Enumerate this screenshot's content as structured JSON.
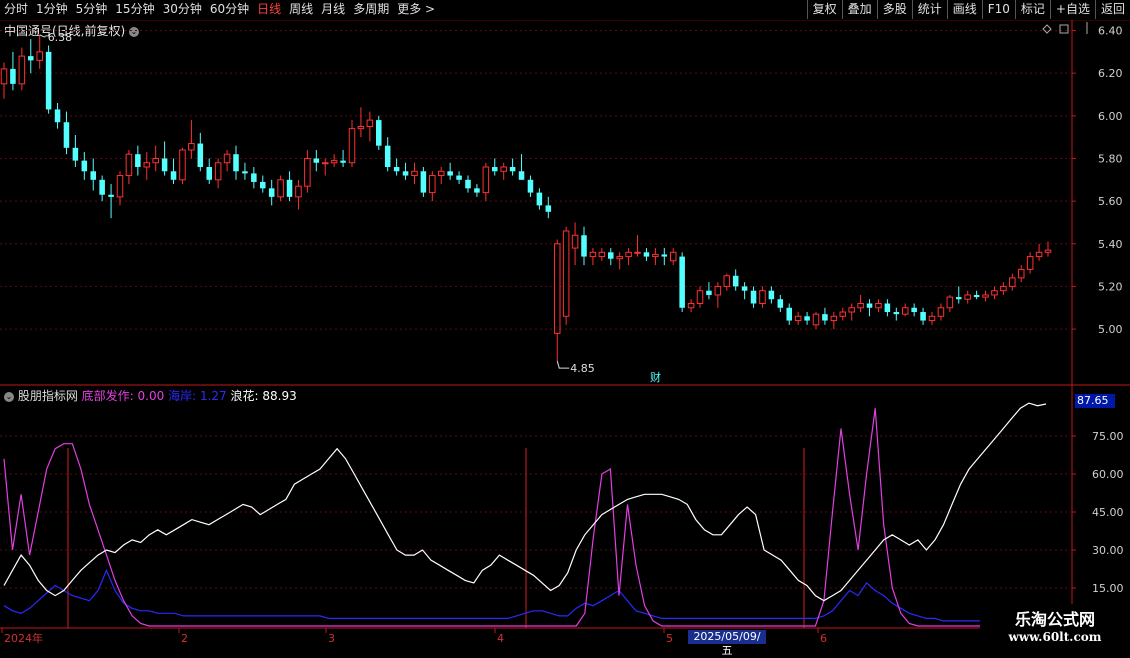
{
  "toolbar": {
    "periods": [
      "分时",
      "1分钟",
      "5分钟",
      "15分钟",
      "30分钟",
      "60分钟",
      "日线",
      "周线",
      "月线",
      "多周期",
      "更多 >"
    ],
    "active_period": "日线",
    "actions": [
      "复权",
      "叠加",
      "多股",
      "统计",
      "画线",
      "F10",
      "标记",
      "+自选",
      "返回"
    ]
  },
  "main": {
    "title": "中国通号(日线,前复权)",
    "high_label": "6.38",
    "low_label": "4.85",
    "event_marker": "财",
    "y_ticks": [
      "6.40",
      "6.20",
      "6.00",
      "5.80",
      "5.60",
      "5.40",
      "5.20",
      "5.00"
    ]
  },
  "indicator": {
    "name": "股朋指标网",
    "items": [
      {
        "label": "底部发作:",
        "value": "0.00",
        "color": "#e040e0"
      },
      {
        "label": "海岸:",
        "value": "1.27",
        "color": "#2a2aff"
      },
      {
        "label": "浪花:",
        "value": "88.93",
        "color": "#ffffff"
      }
    ],
    "current_value": "87.65",
    "y_ticks": [
      "75.00",
      "60.00",
      "45.00",
      "30.00",
      "15.00"
    ]
  },
  "x_axis": {
    "labels": [
      "2024年",
      "2",
      "3",
      "4",
      "5",
      "6"
    ],
    "cursor_date": "2025/05/09/五"
  },
  "watermark": {
    "line1": "乐淘公式网",
    "line2": "www.60lt.com"
  },
  "chart_data": [
    {
      "type": "candlestick",
      "title": "中国通号(日线,前复权)",
      "ylim": [
        4.78,
        6.44
      ],
      "up_color": "#ff3030",
      "down_color": "#54ffff",
      "ohlc": [
        [
          6.15,
          6.25,
          6.08,
          6.22
        ],
        [
          6.22,
          6.3,
          6.12,
          6.15
        ],
        [
          6.15,
          6.32,
          6.12,
          6.28
        ],
        [
          6.28,
          6.36,
          6.2,
          6.26
        ],
        [
          6.26,
          6.38,
          6.22,
          6.3
        ],
        [
          6.3,
          6.33,
          6.01,
          6.03
        ],
        [
          6.03,
          6.06,
          5.94,
          5.97
        ],
        [
          5.97,
          6.02,
          5.82,
          5.85
        ],
        [
          5.85,
          5.91,
          5.76,
          5.79
        ],
        [
          5.79,
          5.83,
          5.7,
          5.74
        ],
        [
          5.74,
          5.8,
          5.65,
          5.7
        ],
        [
          5.7,
          5.72,
          5.6,
          5.63
        ],
        [
          5.63,
          5.68,
          5.52,
          5.62
        ],
        [
          5.62,
          5.74,
          5.58,
          5.72
        ],
        [
          5.72,
          5.84,
          5.68,
          5.82
        ],
        [
          5.82,
          5.86,
          5.72,
          5.76
        ],
        [
          5.76,
          5.83,
          5.7,
          5.78
        ],
        [
          5.78,
          5.86,
          5.74,
          5.8
        ],
        [
          5.8,
          5.88,
          5.72,
          5.74
        ],
        [
          5.74,
          5.8,
          5.68,
          5.7
        ],
        [
          5.7,
          5.85,
          5.68,
          5.84
        ],
        [
          5.84,
          5.98,
          5.8,
          5.87
        ],
        [
          5.87,
          5.92,
          5.74,
          5.76
        ],
        [
          5.76,
          5.8,
          5.68,
          5.7
        ],
        [
          5.7,
          5.8,
          5.66,
          5.78
        ],
        [
          5.78,
          5.84,
          5.74,
          5.82
        ],
        [
          5.82,
          5.86,
          5.7,
          5.74
        ],
        [
          5.74,
          5.78,
          5.7,
          5.73
        ],
        [
          5.73,
          5.76,
          5.66,
          5.69
        ],
        [
          5.69,
          5.72,
          5.64,
          5.66
        ],
        [
          5.66,
          5.7,
          5.58,
          5.62
        ],
        [
          5.62,
          5.72,
          5.6,
          5.7
        ],
        [
          5.7,
          5.74,
          5.6,
          5.62
        ],
        [
          5.62,
          5.7,
          5.56,
          5.67
        ],
        [
          5.67,
          5.84,
          5.64,
          5.8
        ],
        [
          5.8,
          5.84,
          5.74,
          5.78
        ],
        [
          5.78,
          5.8,
          5.72,
          5.78
        ],
        [
          5.78,
          5.82,
          5.76,
          5.79
        ],
        [
          5.79,
          5.84,
          5.76,
          5.78
        ],
        [
          5.78,
          5.98,
          5.76,
          5.94
        ],
        [
          5.94,
          6.04,
          5.9,
          5.95
        ],
        [
          5.95,
          6.02,
          5.88,
          5.98
        ],
        [
          5.98,
          6.0,
          5.84,
          5.86
        ],
        [
          5.86,
          5.9,
          5.74,
          5.76
        ],
        [
          5.76,
          5.8,
          5.72,
          5.74
        ],
        [
          5.74,
          5.78,
          5.7,
          5.72
        ],
        [
          5.72,
          5.78,
          5.68,
          5.74
        ],
        [
          5.74,
          5.76,
          5.62,
          5.64
        ],
        [
          5.64,
          5.74,
          5.6,
          5.72
        ],
        [
          5.72,
          5.76,
          5.68,
          5.74
        ],
        [
          5.74,
          5.78,
          5.7,
          5.72
        ],
        [
          5.72,
          5.74,
          5.68,
          5.7
        ],
        [
          5.7,
          5.72,
          5.64,
          5.66
        ],
        [
          5.66,
          5.68,
          5.62,
          5.64
        ],
        [
          5.64,
          5.78,
          5.6,
          5.76
        ],
        [
          5.76,
          5.8,
          5.72,
          5.74
        ],
        [
          5.74,
          5.78,
          5.7,
          5.76
        ],
        [
          5.76,
          5.8,
          5.72,
          5.74
        ],
        [
          5.74,
          5.82,
          5.7,
          5.7
        ],
        [
          5.7,
          5.72,
          5.62,
          5.64
        ],
        [
          5.64,
          5.66,
          5.56,
          5.58
        ],
        [
          5.58,
          5.62,
          5.52,
          5.55
        ],
        [
          4.98,
          5.42,
          4.85,
          5.4
        ],
        [
          5.06,
          5.48,
          5.02,
          5.46
        ],
        [
          5.38,
          5.5,
          5.3,
          5.44
        ],
        [
          5.44,
          5.48,
          5.3,
          5.34
        ],
        [
          5.34,
          5.38,
          5.3,
          5.36
        ],
        [
          5.34,
          5.38,
          5.32,
          5.36
        ],
        [
          5.36,
          5.38,
          5.3,
          5.33
        ],
        [
          5.33,
          5.36,
          5.28,
          5.34
        ],
        [
          5.34,
          5.38,
          5.3,
          5.36
        ],
        [
          5.36,
          5.44,
          5.34,
          5.36
        ],
        [
          5.36,
          5.38,
          5.32,
          5.34
        ],
        [
          5.34,
          5.38,
          5.3,
          5.35
        ],
        [
          5.35,
          5.38,
          5.3,
          5.34
        ],
        [
          5.32,
          5.38,
          5.3,
          5.36
        ],
        [
          5.34,
          5.36,
          5.08,
          5.1
        ],
        [
          5.1,
          5.14,
          5.08,
          5.12
        ],
        [
          5.12,
          5.2,
          5.1,
          5.18
        ],
        [
          5.18,
          5.22,
          5.14,
          5.16
        ],
        [
          5.16,
          5.22,
          5.1,
          5.2
        ],
        [
          5.2,
          5.26,
          5.18,
          5.25
        ],
        [
          5.25,
          5.28,
          5.18,
          5.2
        ],
        [
          5.2,
          5.22,
          5.14,
          5.18
        ],
        [
          5.18,
          5.2,
          5.1,
          5.12
        ],
        [
          5.12,
          5.2,
          5.1,
          5.18
        ],
        [
          5.18,
          5.2,
          5.12,
          5.14
        ],
        [
          5.14,
          5.16,
          5.08,
          5.1
        ],
        [
          5.1,
          5.12,
          5.02,
          5.04
        ],
        [
          5.04,
          5.08,
          5.02,
          5.06
        ],
        [
          5.06,
          5.08,
          5.02,
          5.04
        ],
        [
          5.02,
          5.08,
          5.0,
          5.07
        ],
        [
          5.07,
          5.1,
          5.02,
          5.04
        ],
        [
          5.04,
          5.08,
          5.0,
          5.06
        ],
        [
          5.06,
          5.1,
          5.04,
          5.08
        ],
        [
          5.08,
          5.12,
          5.04,
          5.1
        ],
        [
          5.1,
          5.16,
          5.08,
          5.12
        ],
        [
          5.12,
          5.14,
          5.06,
          5.1
        ],
        [
          5.1,
          5.14,
          5.08,
          5.12
        ],
        [
          5.12,
          5.14,
          5.06,
          5.08
        ],
        [
          5.08,
          5.1,
          5.04,
          5.07
        ],
        [
          5.07,
          5.12,
          5.06,
          5.1
        ],
        [
          5.1,
          5.12,
          5.06,
          5.08
        ],
        [
          5.08,
          5.1,
          5.02,
          5.04
        ],
        [
          5.04,
          5.08,
          5.02,
          5.06
        ],
        [
          5.06,
          5.12,
          5.04,
          5.1
        ],
        [
          5.1,
          5.16,
          5.08,
          5.15
        ],
        [
          5.15,
          5.2,
          5.12,
          5.14
        ],
        [
          5.14,
          5.18,
          5.12,
          5.16
        ],
        [
          5.16,
          5.18,
          5.14,
          5.15
        ],
        [
          5.15,
          5.18,
          5.13,
          5.16
        ],
        [
          5.16,
          5.2,
          5.14,
          5.18
        ],
        [
          5.18,
          5.22,
          5.16,
          5.2
        ],
        [
          5.2,
          5.26,
          5.18,
          5.24
        ],
        [
          5.24,
          5.3,
          5.22,
          5.28
        ],
        [
          5.28,
          5.36,
          5.26,
          5.34
        ],
        [
          5.34,
          5.4,
          5.32,
          5.36
        ],
        [
          5.36,
          5.41,
          5.34,
          5.37
        ]
      ]
    },
    {
      "type": "line",
      "title": "股朋指标网",
      "ylim": [
        0,
        92
      ],
      "series": [
        {
          "name": "浪花",
          "color": "#ffffff",
          "values": [
            16,
            22,
            28,
            24,
            18,
            14,
            12,
            14,
            18,
            22,
            25,
            28,
            30,
            29,
            32,
            34,
            33,
            36,
            38,
            36,
            38,
            40,
            42,
            41,
            40,
            42,
            44,
            46,
            48,
            47,
            44,
            46,
            48,
            50,
            56,
            58,
            60,
            62,
            66,
            70,
            66,
            60,
            54,
            48,
            42,
            36,
            30,
            28,
            28,
            30,
            26,
            24,
            22,
            20,
            18,
            17,
            22,
            24,
            28,
            26,
            24,
            22,
            20,
            17,
            14,
            16,
            21,
            30,
            36,
            40,
            44,
            46,
            48,
            50,
            51,
            52,
            52,
            52,
            51,
            50,
            48,
            42,
            38,
            36,
            36,
            40,
            44,
            47,
            44,
            30,
            28,
            26,
            22,
            18,
            16,
            12,
            10,
            12,
            14,
            18,
            22,
            26,
            30,
            34,
            36,
            34,
            32,
            34,
            30,
            34,
            40,
            48,
            56,
            62,
            66,
            70,
            74,
            78,
            82,
            86,
            88,
            87,
            87.65
          ]
        },
        {
          "name": "底部发作",
          "color": "#e040e0",
          "values": [
            66,
            30,
            52,
            28,
            45,
            62,
            70,
            72,
            72,
            62,
            48,
            38,
            28,
            18,
            10,
            4,
            1,
            0,
            0,
            0,
            0,
            0,
            0,
            0,
            0,
            0,
            0,
            0,
            0,
            0,
            0,
            0,
            0,
            0,
            0,
            0,
            0,
            0,
            0,
            0,
            0,
            0,
            0,
            0,
            0,
            0,
            0,
            0,
            0,
            0,
            0,
            0,
            0,
            0,
            0,
            0,
            0,
            0,
            0,
            0,
            0,
            0,
            0,
            0,
            0,
            0,
            0,
            0,
            5,
            35,
            60,
            62,
            12,
            48,
            24,
            8,
            2,
            0,
            0,
            0,
            0,
            0,
            0,
            0,
            0,
            0,
            0,
            0,
            0,
            0,
            0,
            0,
            0,
            0,
            0,
            0,
            10,
            45,
            78,
            52,
            30,
            60,
            86,
            40,
            15,
            5,
            1,
            0,
            0,
            0,
            0,
            0,
            0,
            0,
            0,
            0,
            0,
            0,
            0,
            0,
            0,
            0,
            0
          ]
        },
        {
          "name": "海岸",
          "color": "#2a2aff",
          "values": [
            8,
            6,
            5,
            7,
            10,
            13,
            16,
            14,
            12,
            11,
            10,
            14,
            22,
            14,
            9,
            7,
            6,
            6,
            5,
            5,
            5,
            4,
            4,
            4,
            4,
            4,
            4,
            4,
            4,
            4,
            4,
            4,
            4,
            4,
            4,
            4,
            4,
            4,
            3,
            3,
            3,
            3,
            3,
            3,
            3,
            3,
            3,
            3,
            3,
            3,
            3,
            3,
            3,
            3,
            3,
            3,
            3,
            3,
            3,
            3,
            4,
            5,
            6,
            6,
            5,
            4,
            4,
            7,
            9,
            8,
            10,
            12,
            14,
            10,
            6,
            5,
            4,
            3,
            3,
            3,
            3,
            3,
            3,
            3,
            3,
            3,
            3,
            3,
            3,
            3,
            3,
            3,
            3,
            3,
            3,
            3,
            4,
            6,
            10,
            14,
            12,
            17,
            14,
            12,
            9,
            7,
            5,
            4,
            3,
            3,
            2,
            2,
            2,
            2,
            2,
            2,
            2,
            2,
            2,
            1.5,
            1.3,
            1.3,
            1.27
          ]
        }
      ]
    }
  ]
}
